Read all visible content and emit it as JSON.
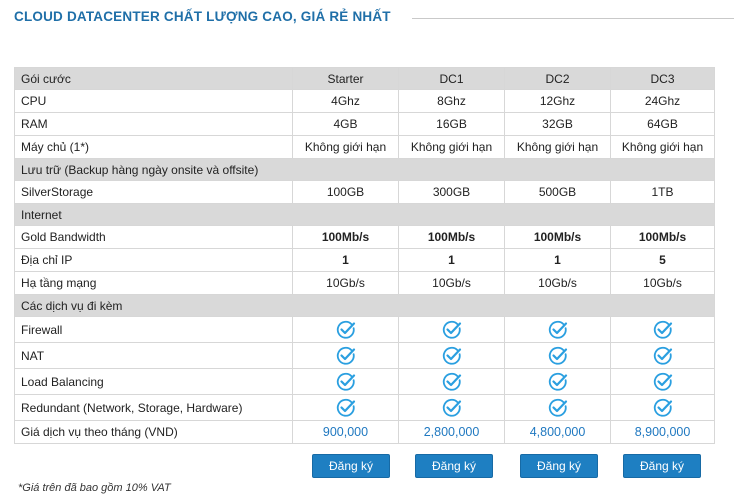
{
  "heading": "CLOUD DATACENTER CHẤT LƯỢNG CAO, GIÁ RẺ NHẤT",
  "table": {
    "header": [
      "Gói cước",
      "Starter",
      "DC1",
      "DC2",
      "DC3"
    ],
    "rows": [
      {
        "label": "CPU",
        "values": [
          "4Ghz",
          "8Ghz",
          "12Ghz",
          "24Ghz"
        ]
      },
      {
        "label": "RAM",
        "values": [
          "4GB",
          "16GB",
          "32GB",
          "64GB"
        ]
      },
      {
        "label": "Máy chủ (1*)",
        "values": [
          "Không giới hạn",
          "Không giới hạn",
          "Không giới hạn",
          "Không giới hạn"
        ]
      },
      {
        "section": "Lưu trữ (Backup hàng ngày onsite và offsite)"
      },
      {
        "label": "SilverStorage",
        "values": [
          "100GB",
          "300GB",
          "500GB",
          "1TB"
        ]
      },
      {
        "section": "Internet"
      },
      {
        "label": "Gold Bandwidth",
        "values": [
          "100Mb/s",
          "100Mb/s",
          "100Mb/s",
          "100Mb/s"
        ],
        "bold": true
      },
      {
        "label": "Địa chỉ IP",
        "values": [
          "1",
          "1",
          "1",
          "5"
        ],
        "bold": true
      },
      {
        "label": "Hạ tầng mạng",
        "values": [
          "10Gb/s",
          "10Gb/s",
          "10Gb/s",
          "10Gb/s"
        ]
      },
      {
        "section": "Các dịch vụ đi kèm"
      },
      {
        "label": "Firewall",
        "check": true
      },
      {
        "label": "NAT",
        "check": true
      },
      {
        "label": "Load Balancing",
        "check": true
      },
      {
        "label": "Redundant (Network, Storage, Hardware)",
        "check": true
      },
      {
        "label": "Giá dịch vụ theo tháng (VND)",
        "values": [
          "900,000",
          "2,800,000",
          "4,800,000",
          "8,900,000"
        ],
        "price": true
      }
    ]
  },
  "signup_label": "Đăng ký",
  "note": "*Giá trên đã bao gồm 10% VAT",
  "colors": {
    "accent": "#1f78c0",
    "button": "#1e7fc2",
    "check": "#2a9fe0",
    "section_bg": "#d9d9d9"
  },
  "icons": {
    "included": "checkmark-circle-icon"
  }
}
